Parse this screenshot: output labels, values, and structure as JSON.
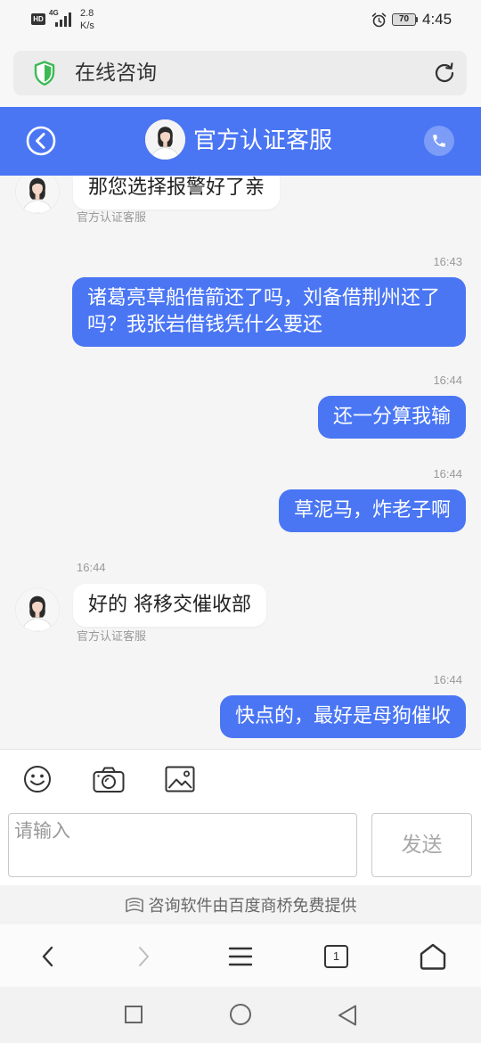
{
  "colors": {
    "accent": "#4a76f4",
    "chat_background": "#f5f5f5",
    "secure_green": "#3cba54",
    "meta_text": "#999999"
  },
  "status_bar": {
    "hd": "HD",
    "network": "4G",
    "speed_value": "2.8",
    "speed_unit": "K/s",
    "battery": "70",
    "time": "4:45",
    "icons": [
      "signal-icon",
      "alarm-icon",
      "battery-icon"
    ]
  },
  "address_bar": {
    "title": "在线咨询",
    "icons": [
      "shield-icon",
      "refresh-icon"
    ]
  },
  "header": {
    "title": "官方认证客服",
    "icons": [
      "back-icon",
      "agent-avatar",
      "phone-icon"
    ]
  },
  "messages": [
    {
      "direction": "incoming",
      "text": "那您选择报警好了亲",
      "sender": "官方认证客服"
    },
    {
      "direction": "outgoing",
      "time": "16:43",
      "text": "诸葛亮草船借箭还了吗，刘备借荆州还了吗？我张岩借钱凭什么要还"
    },
    {
      "direction": "outgoing",
      "time": "16:44",
      "text": "还一分算我输"
    },
    {
      "direction": "outgoing",
      "time": "16:44",
      "text": "草泥马，炸老子啊"
    },
    {
      "direction": "incoming",
      "time": "16:44",
      "text": "好的 将移交催收部",
      "sender": "官方认证客服"
    },
    {
      "direction": "outgoing",
      "time": "16:44",
      "text": "快点的，最好是母狗催收"
    }
  ],
  "toolbar": {
    "icons": [
      "emoji-icon",
      "camera-icon",
      "image-icon"
    ]
  },
  "composer": {
    "placeholder": "请输入",
    "send_label": "发送"
  },
  "footer": {
    "text": "咨询软件由百度商桥免费提供",
    "icon": "baidu-shangqiao-icon"
  },
  "browser_nav": {
    "tab_count": "1",
    "icons": [
      "back-chevron-icon",
      "forward-chevron-icon",
      "menu-icon",
      "tabs-icon",
      "home-icon"
    ]
  },
  "system_nav": {
    "icons": [
      "recents-icon",
      "home-circle-icon",
      "back-triangle-icon"
    ]
  }
}
